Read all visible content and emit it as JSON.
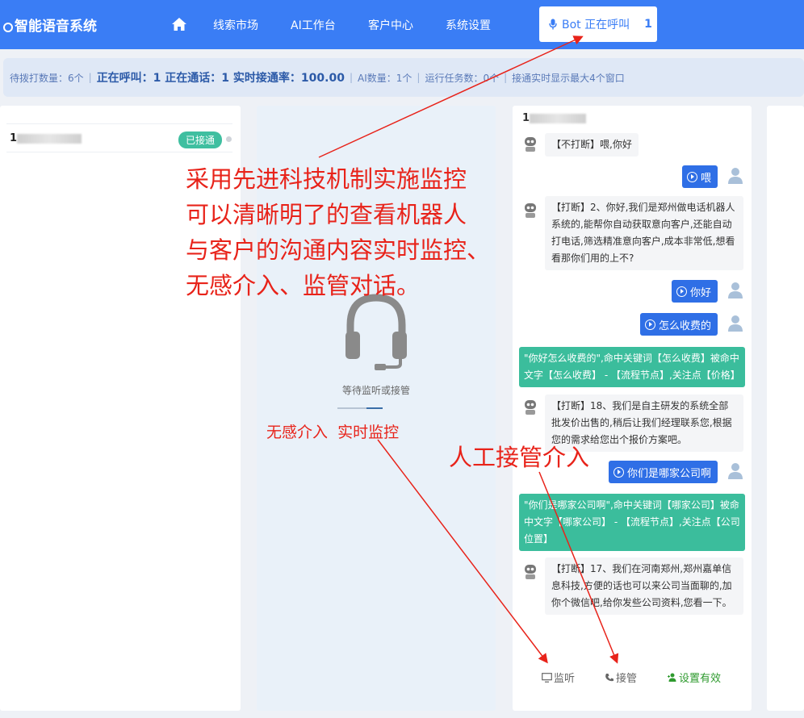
{
  "header": {
    "brand": "智能语音系统",
    "nav": [
      "线索市场",
      "AI工作台",
      "客户中心",
      "系统设置"
    ],
    "call_label": "Bot 正在呼叫",
    "call_count": "1"
  },
  "status": {
    "pending": "待拨打数量：6个",
    "live": "正在呼叫：1 正在通话：1 实时接通率：100.00",
    "ai_count": "AI数量：1个",
    "tasks": "运行任务数：0个",
    "note": "接通实时显示最大4个窗口"
  },
  "list": {
    "number_prefix": "1",
    "badge": "已接通"
  },
  "monitor": {
    "wait_text": "等待监听或接管"
  },
  "chat": {
    "number_prefix": "1",
    "messages": [
      {
        "type": "bot",
        "text": "【不打断】喂,你好"
      },
      {
        "type": "user",
        "text": "喂"
      },
      {
        "type": "bot",
        "text": "【打断】2、你好,我们是郑州做电话机器人系统的,能帮你自动获取意向客户,还能自动打电话,筛选精准意向客户,成本非常低,想看看那你们用的上不?"
      },
      {
        "type": "user",
        "text": "你好"
      },
      {
        "type": "user",
        "text": "怎么收费的"
      },
      {
        "type": "hit",
        "text": "\"你好怎么收费的\",命中关键词【怎么收费】被命中文字【怎么收费】 - 【流程节点】,关注点【价格】"
      },
      {
        "type": "bot",
        "text": "【打断】18、我们是自主研发的系统全部批发价出售的,稍后让我们经理联系您,根据您的需求给您出个报价方案吧。"
      },
      {
        "type": "user",
        "text": "你们是哪家公司啊"
      },
      {
        "type": "hit",
        "text": "\"你们是哪家公司啊\",命中关键词【哪家公司】被命中文字【哪家公司】 - 【流程节点】,关注点【公司位置】"
      },
      {
        "type": "bot",
        "text": "【打断】17、我们在河南郑州,郑州嘉单信息科技,方便的话也可以来公司当面聊的,加你个微信吧,给你发些公司资料,您看一下。"
      }
    ],
    "actions": {
      "listen": "监听",
      "takeover": "接管",
      "set_valid": "设置有效"
    }
  },
  "annotations": {
    "main": [
      "采用先进科技机制实施监控",
      "可以清晰明了的查看机器人",
      "与客户的沟通内容实时监控、",
      "无感介入、监管对话。"
    ],
    "mid": "无感介入  实时监控",
    "takeover": "人工接管介入"
  },
  "colors": {
    "primary": "#3a7df5",
    "user_bubble": "#2f6fe6",
    "hit": "#3bbd9c",
    "annotation": "#e8231a"
  }
}
